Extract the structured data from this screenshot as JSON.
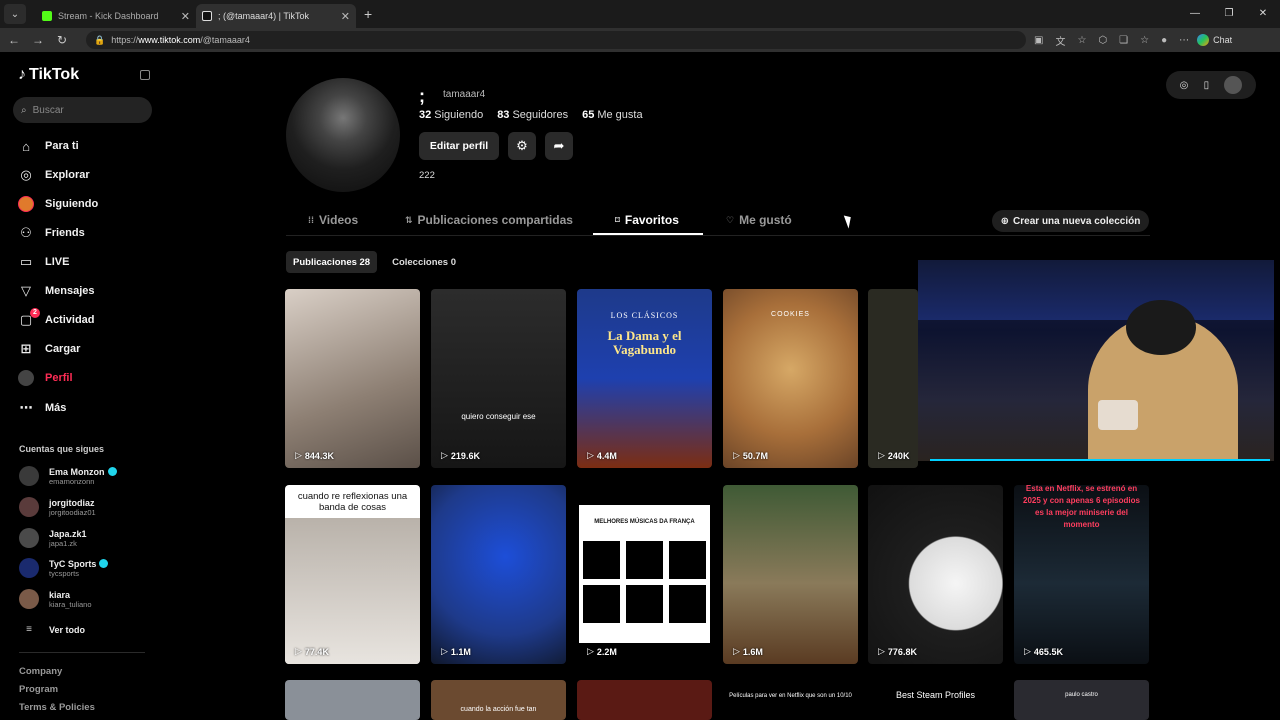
{
  "browser": {
    "tabs": [
      {
        "title": "Stream - Kick Dashboard",
        "color": "#53fc18"
      },
      {
        "title": "; (@tamaaar4) | TikTok",
        "color": "#ffffff"
      }
    ],
    "url_prefix": "https://",
    "url_host": "www.tiktok.com",
    "url_path": "/@tamaaar4",
    "chat_label": "Chat"
  },
  "sidebar": {
    "brand": "TikTok",
    "search_placeholder": "Buscar",
    "nav": [
      {
        "label": "Para ti",
        "icon": "home-icon"
      },
      {
        "label": "Explorar",
        "icon": "compass-icon"
      },
      {
        "label": "Siguiendo",
        "icon": "live-avatar-icon"
      },
      {
        "label": "Friends",
        "icon": "friends-icon"
      },
      {
        "label": "LIVE",
        "icon": "live-tv-icon"
      },
      {
        "label": "Mensajes",
        "icon": "messages-icon"
      },
      {
        "label": "Actividad",
        "icon": "activity-icon",
        "badge": "2"
      },
      {
        "label": "Cargar",
        "icon": "upload-icon"
      },
      {
        "label": "Perfil",
        "icon": "profile-avatar-icon"
      },
      {
        "label": "Más",
        "icon": "more-icon"
      }
    ],
    "following_title": "Cuentas que sigues",
    "accounts": [
      {
        "name": "Ema Monzon",
        "handle": "emamonzonn",
        "verified": true,
        "color": "#3a3a3a"
      },
      {
        "name": "jorgitodiaz",
        "handle": "jorgitoodiaz01",
        "verified": false,
        "color": "#5a3b3b"
      },
      {
        "name": "Japa.zk1",
        "handle": "japa1.zk",
        "verified": false,
        "color": "#4a4a4a"
      },
      {
        "name": "TyC Sports",
        "handle": "tycsports",
        "verified": true,
        "color": "#1a2a6e"
      },
      {
        "name": "kiara",
        "handle": "kiara_tuliano",
        "verified": false,
        "color": "#7a5a48"
      }
    ],
    "see_all": "Ver todo",
    "footer": [
      "Company",
      "Program",
      "Terms & Policies"
    ]
  },
  "profile": {
    "display_name": ";",
    "username": "tamaaar4",
    "following_count": "32",
    "following_label": "Siguiendo",
    "followers_count": "83",
    "followers_label": "Seguidores",
    "likes_count": "65",
    "likes_label": "Me gusta",
    "edit_button": "Editar perfil",
    "bio": "222"
  },
  "tabs": [
    {
      "label": "Videos",
      "icon": "grid-icon"
    },
    {
      "label": "Publicaciones compartidas",
      "icon": "repost-icon"
    },
    {
      "label": "Favoritos",
      "icon": "bookmark-icon"
    },
    {
      "label": "Me gustó",
      "icon": "heart-icon"
    }
  ],
  "active_tab": "Favoritos",
  "create_collection": "Crear una nueva colección",
  "subtabs": [
    "Publicaciones 28",
    "Colecciones 0"
  ],
  "posts_row1": [
    {
      "views": "844.3K",
      "bg": "#b8a99c"
    },
    {
      "views": "219.6K",
      "bg": "#222222",
      "caption": "quiero conseguir ese"
    },
    {
      "views": "4.4M",
      "bg": "#1e3a8a",
      "poster_top": "LOS CLÁSICOS",
      "poster_title": "La Dama y el Vagabundo"
    },
    {
      "views": "50.7M",
      "bg": "#c79a5a",
      "caption": "COOKIES"
    },
    {
      "views": "240K",
      "bg": "#2a2a22"
    }
  ],
  "posts_row2": [
    {
      "views": "77.4K",
      "bg": "#ffffff",
      "caption": "cuando re reflexionas una banda de cosas"
    },
    {
      "views": "1.1M",
      "bg": "#1e40af"
    },
    {
      "views": "2.2M",
      "bg": "#ffffff",
      "caption": "MELHORES MÚSICAS DA FRANÇA"
    },
    {
      "views": "1.6M",
      "bg": "#6b5a3c"
    },
    {
      "views": "776.8K",
      "bg": "#1e1e1e"
    },
    {
      "views": "465.5K",
      "bg": "#111820",
      "caption": "Esta en Netflix, se estrenó en 2025 y con apenas 6 episodios es la mejor miniserie del momento"
    }
  ],
  "posts_row3": [
    {
      "bg": "#8a9098"
    },
    {
      "bg": "#6b4a30",
      "caption": "cuando la acción fue tan"
    },
    {
      "bg": "#5a1a14"
    },
    {
      "bg": "#000000",
      "caption": "Películas para ver en Netflix que son un 10/10"
    },
    {
      "bg": "#000000",
      "caption": "Best Steam Profiles"
    },
    {
      "bg": "#2a2a30",
      "caption": "paulo castro"
    }
  ]
}
